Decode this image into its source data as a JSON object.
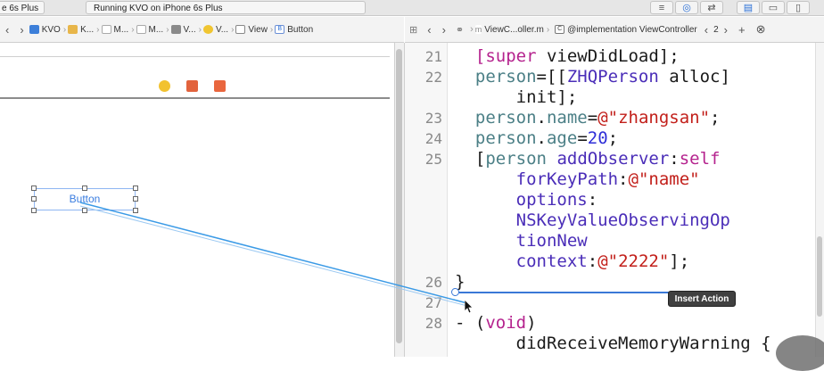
{
  "toolbar": {
    "scheme_label": "e 6s Plus",
    "status_text": "Running KVO on iPhone 6s Plus",
    "button_icons": [
      "lines-icon",
      "venn-icon",
      "arrows-icon",
      "navigator-icon",
      "debug-area-icon",
      "utilities-icon"
    ]
  },
  "left_jumpbar": {
    "crumbs": [
      {
        "label": "KVO",
        "icon": "project-icon"
      },
      {
        "label": "K...",
        "icon": "folder-icon"
      },
      {
        "label": "M...",
        "icon": "file-icon"
      },
      {
        "label": "M...",
        "icon": "file-icon"
      },
      {
        "label": "V...",
        "icon": "scene-icon"
      },
      {
        "label": "V...",
        "icon": "view-controller-icon"
      },
      {
        "label": "View",
        "icon": "view-icon"
      },
      {
        "label": "Button",
        "icon": "button-icon"
      }
    ]
  },
  "right_jumpbar": {
    "file_label": "ViewC...oller.m",
    "symbol_label": "@implementation ViewController",
    "counter": "2"
  },
  "canvas": {
    "button_title": "Button"
  },
  "editor": {
    "lines": [
      {
        "n": "21",
        "parts": [
          [
            "kw",
            "[super"
          ],
          [
            "plain",
            " viewDidLoad];"
          ]
        ]
      },
      {
        "n": "22",
        "parts": [
          [
            "prop",
            "person"
          ],
          [
            "plain",
            "=[["
          ],
          [
            "cls",
            "ZHQPerson"
          ],
          [
            "plain",
            " alloc]"
          ]
        ]
      },
      {
        "n": "",
        "parts": [
          [
            "plain",
            "    init];"
          ]
        ]
      },
      {
        "n": "23",
        "parts": [
          [
            "prop",
            "person"
          ],
          [
            "plain",
            "."
          ],
          [
            "prop",
            "name"
          ],
          [
            "plain",
            "="
          ],
          [
            "str",
            "@\"zhangsan\""
          ],
          [
            "plain",
            ";"
          ]
        ]
      },
      {
        "n": "24",
        "parts": [
          [
            "prop",
            "person"
          ],
          [
            "plain",
            "."
          ],
          [
            "prop",
            "age"
          ],
          [
            "plain",
            "="
          ],
          [
            "num",
            "20"
          ],
          [
            "plain",
            ";"
          ]
        ]
      },
      {
        "n": "25",
        "parts": [
          [
            "plain",
            "["
          ],
          [
            "prop",
            "person"
          ],
          [
            "plain",
            " "
          ],
          [
            "purp",
            "addObserver"
          ],
          [
            "plain",
            ":"
          ],
          [
            "kw",
            "self"
          ]
        ]
      },
      {
        "n": "",
        "parts": [
          [
            "plain",
            "    "
          ],
          [
            "purp",
            "forKeyPath"
          ],
          [
            "plain",
            ":"
          ],
          [
            "str",
            "@\"name\""
          ]
        ]
      },
      {
        "n": "",
        "parts": [
          [
            "plain",
            "    "
          ],
          [
            "purp",
            "options"
          ],
          [
            "plain",
            ":"
          ]
        ]
      },
      {
        "n": "",
        "parts": [
          [
            "plain",
            "    "
          ],
          [
            "purp",
            "NSKeyValueObservingOp"
          ]
        ]
      },
      {
        "n": "",
        "parts": [
          [
            "plain",
            "    "
          ],
          [
            "purp",
            "tionNew"
          ]
        ]
      },
      {
        "n": "",
        "parts": [
          [
            "plain",
            "    "
          ],
          [
            "purp",
            "context"
          ],
          [
            "plain",
            ":"
          ],
          [
            "str",
            "@\"2222\""
          ],
          [
            "plain",
            "];"
          ]
        ]
      },
      {
        "n": "26",
        "parts": [
          [
            "plain",
            "}"
          ]
        ]
      },
      {
        "n": "27",
        "parts": [
          [
            "plain",
            ""
          ]
        ]
      },
      {
        "n": "28",
        "parts": [
          [
            "plain",
            "- ("
          ],
          [
            "kw",
            "void"
          ],
          [
            "plain",
            ")"
          ]
        ]
      },
      {
        "n": "",
        "parts": [
          [
            "plain",
            "    didReceiveMemoryWarning {"
          ]
        ]
      }
    ]
  },
  "insert_tooltip": "Insert Action",
  "colors": {
    "connection_line": "#3a9ae6",
    "keyword": "#b5238e",
    "string": "#c21f1a",
    "number": "#2f2fd8"
  }
}
